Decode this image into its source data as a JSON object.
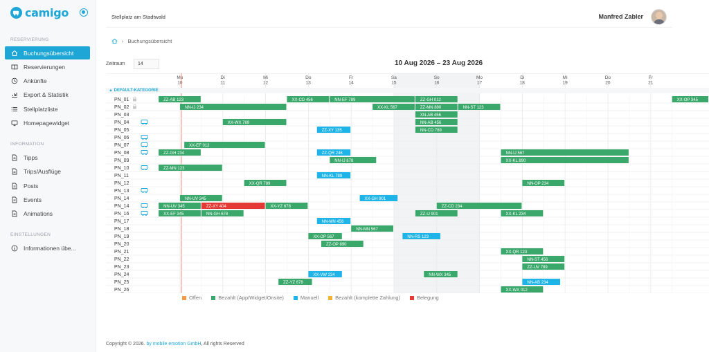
{
  "app": {
    "brand": "camigo",
    "site": "Stellplatz am Stadtwald",
    "user": "Manfred Zabler"
  },
  "sidebar": {
    "sections": [
      {
        "title": "RESERVIERUNG",
        "items": [
          {
            "label": "Buchungsübersicht",
            "icon": "home-icon",
            "active": true
          },
          {
            "label": "Reservierungen",
            "icon": "book-icon"
          },
          {
            "label": "Ankünfte",
            "icon": "clock-icon"
          },
          {
            "label": "Export & Statistik",
            "icon": "chart-icon"
          },
          {
            "label": "Stellplatzliste",
            "icon": "list-icon"
          },
          {
            "label": "Homepagewidget",
            "icon": "monitor-icon"
          }
        ]
      },
      {
        "title": "INFORMATION",
        "items": [
          {
            "label": "Tipps",
            "icon": "doc-icon"
          },
          {
            "label": "Trips/Ausflüge",
            "icon": "doc-icon"
          },
          {
            "label": "Posts",
            "icon": "doc-icon"
          },
          {
            "label": "Events",
            "icon": "doc-icon"
          },
          {
            "label": "Animations",
            "icon": "doc-icon"
          }
        ]
      },
      {
        "title": "EINSTELLUNGEN",
        "items": [
          {
            "label": "Informationen übe...",
            "icon": "info-icon"
          }
        ]
      }
    ]
  },
  "breadcrumb": {
    "current": "Buchungsübersicht"
  },
  "calendar": {
    "range_label": "10 Aug 2026 – 23 Aug 2026",
    "zeitraum_label": "Zeitraum",
    "zeitraum_value": "14",
    "category": "DEFAULT-KATEGORIE",
    "days": [
      {
        "dow": "Mo",
        "d": "10"
      },
      {
        "dow": "Di",
        "d": "11"
      },
      {
        "dow": "Mi",
        "d": "12"
      },
      {
        "dow": "Do",
        "d": "13"
      },
      {
        "dow": "Fr",
        "d": "14"
      },
      {
        "dow": "Sa",
        "d": "15"
      },
      {
        "dow": "So",
        "d": "16"
      },
      {
        "dow": "Mo",
        "d": "17"
      },
      {
        "dow": "Di",
        "d": "18"
      },
      {
        "dow": "Mi",
        "d": "19"
      },
      {
        "dow": "Do",
        "d": "20"
      },
      {
        "dow": "Fr",
        "d": "21"
      }
    ],
    "weekend_cols": [
      5,
      6
    ],
    "pitches": [
      {
        "name": "PN_01",
        "icon": "lock-icon"
      },
      {
        "name": "PN_02",
        "icon": "lock-icon"
      },
      {
        "name": "PN_03",
        "icon": ""
      },
      {
        "name": "PN_04",
        "icon": "camper-icon"
      },
      {
        "name": "PN_05",
        "icon": ""
      },
      {
        "name": "PN_06",
        "icon": "camper-icon"
      },
      {
        "name": "PN_07",
        "icon": "camper-icon"
      },
      {
        "name": "PN_08",
        "icon": "camper-icon"
      },
      {
        "name": "PN_09",
        "icon": ""
      },
      {
        "name": "PN_10",
        "icon": "camper-icon"
      },
      {
        "name": "PN_11",
        "icon": ""
      },
      {
        "name": "PN_12",
        "icon": ""
      },
      {
        "name": "PN_13",
        "icon": "camper-icon"
      },
      {
        "name": "PN_14",
        "icon": ""
      },
      {
        "name": "PN_14",
        "icon": "camper-icon"
      },
      {
        "name": "PN_16",
        "icon": "camper-icon"
      },
      {
        "name": "PN_17",
        "icon": ""
      },
      {
        "name": "PN_18",
        "icon": ""
      },
      {
        "name": "PN_19",
        "icon": ""
      },
      {
        "name": "PN_20",
        "icon": ""
      },
      {
        "name": "PN_21",
        "icon": ""
      },
      {
        "name": "PN_22",
        "icon": ""
      },
      {
        "name": "PN_23",
        "icon": ""
      },
      {
        "name": "PN_24",
        "icon": ""
      },
      {
        "name": "PN_25",
        "icon": ""
      },
      {
        "name": "PN_26",
        "icon": ""
      }
    ],
    "bookings": [
      {
        "row": 0,
        "start": -0.5,
        "end": 0.5,
        "label": "ZZ-AB 123",
        "status": "paid"
      },
      {
        "row": 0,
        "start": 2.5,
        "end": 3.5,
        "label": "XX-CD 456",
        "status": "paid"
      },
      {
        "row": 0,
        "start": 3.5,
        "end": 5.5,
        "label": "NN-EF 789",
        "status": "paid"
      },
      {
        "row": 0,
        "start": 5.5,
        "end": 6.5,
        "label": "ZZ-GH 012",
        "status": "paid"
      },
      {
        "row": 0,
        "start": 11.5,
        "end": 12.5,
        "label": "XX-OP 345",
        "status": "paid"
      },
      {
        "row": 1,
        "start": 0,
        "end": 2.5,
        "label": "NN-IJ 234",
        "status": "paid"
      },
      {
        "row": 1,
        "start": 4.5,
        "end": 5.5,
        "label": "XX-KL 567",
        "status": "paid"
      },
      {
        "row": 1,
        "start": 5.5,
        "end": 6.5,
        "label": "ZZ-MN 890",
        "status": "paid"
      },
      {
        "row": 1,
        "start": 6.5,
        "end": 7.5,
        "label": "NN-ST 123",
        "status": "paid"
      },
      {
        "row": 2,
        "start": 5.5,
        "end": 6.5,
        "label": "XN-AB 456",
        "status": "paid"
      },
      {
        "row": 3,
        "start": 1,
        "end": 2.5,
        "label": "XX-WX 789",
        "status": "paid"
      },
      {
        "row": 3,
        "start": 5.5,
        "end": 6.5,
        "label": "NN-AB 456",
        "status": "paid"
      },
      {
        "row": 4,
        "start": 3.2,
        "end": 4,
        "label": "ZZ-XY 135",
        "status": "manual"
      },
      {
        "row": 4,
        "start": 5.5,
        "end": 6.5,
        "label": "NN-CD 789",
        "status": "paid"
      },
      {
        "row": 6,
        "start": 0.1,
        "end": 2,
        "label": "XX-EF 012",
        "status": "paid"
      },
      {
        "row": 7,
        "start": -0.5,
        "end": 0.5,
        "label": "ZZ-GH 234",
        "status": "paid"
      },
      {
        "row": 7,
        "start": 3.2,
        "end": 4,
        "label": "ZZ-QR 246",
        "status": "manual"
      },
      {
        "row": 7,
        "start": 7.5,
        "end": 10.5,
        "label": "NN-IJ 567",
        "status": "paid"
      },
      {
        "row": 8,
        "start": 3.5,
        "end": 4.6,
        "label": "NN-IJ 678",
        "status": "paid"
      },
      {
        "row": 8,
        "start": 7.5,
        "end": 10.5,
        "label": "XX-KL 890",
        "status": "paid"
      },
      {
        "row": 9,
        "start": -0.5,
        "end": 1,
        "label": "ZZ-MN 123",
        "status": "paid"
      },
      {
        "row": 10,
        "start": 3.2,
        "end": 4,
        "label": "NN-KL 789",
        "status": "manual"
      },
      {
        "row": 11,
        "start": 1.5,
        "end": 2.5,
        "label": "XX-QR 789",
        "status": "paid"
      },
      {
        "row": 11,
        "start": 8,
        "end": 9,
        "label": "NN-OP 234",
        "status": "paid"
      },
      {
        "row": 13,
        "start": 0,
        "end": 1,
        "label": "NN-UV 345",
        "status": "paid"
      },
      {
        "row": 13,
        "start": 4.2,
        "end": 5.1,
        "label": "XX-GH 901",
        "status": "manual"
      },
      {
        "row": 14,
        "start": -0.5,
        "end": 0.5,
        "label": "NN-UV 345",
        "status": "paid"
      },
      {
        "row": 14,
        "start": 0.5,
        "end": 2,
        "label": "ZZ-XY 404",
        "status": "blocked"
      },
      {
        "row": 14,
        "start": 2,
        "end": 3,
        "label": "XX-YZ 678",
        "status": "paid"
      },
      {
        "row": 14,
        "start": 6,
        "end": 8,
        "label": "ZZ-CD 234",
        "status": "paid"
      },
      {
        "row": 15,
        "start": -0.5,
        "end": 0.5,
        "label": "XX-EF 345",
        "status": "paid"
      },
      {
        "row": 15,
        "start": 0.5,
        "end": 1.5,
        "label": "NN-GH 678",
        "status": "paid"
      },
      {
        "row": 15,
        "start": 5.5,
        "end": 6.5,
        "label": "ZZ-IJ 901",
        "status": "paid"
      },
      {
        "row": 15,
        "start": 7.5,
        "end": 8.5,
        "label": "XX-KL 234",
        "status": "paid"
      },
      {
        "row": 16,
        "start": 3.2,
        "end": 4,
        "label": "NN-MN 456",
        "status": "manual"
      },
      {
        "row": 17,
        "start": 4,
        "end": 5,
        "label": "NN-MN 567",
        "status": "paid"
      },
      {
        "row": 18,
        "start": 3,
        "end": 3.8,
        "label": "XX-OP 567",
        "status": "paid"
      },
      {
        "row": 18,
        "start": 5.2,
        "end": 6.1,
        "label": "NN-RS 123",
        "status": "manual"
      },
      {
        "row": 19,
        "start": 3.3,
        "end": 4.3,
        "label": "ZZ-OP 890",
        "status": "paid"
      },
      {
        "row": 20,
        "start": 7.5,
        "end": 8.5,
        "label": "XX-QR 123",
        "status": "paid"
      },
      {
        "row": 21,
        "start": 8,
        "end": 9,
        "label": "NN-ST 456",
        "status": "paid"
      },
      {
        "row": 22,
        "start": 8,
        "end": 9,
        "label": "ZZ-UV 789",
        "status": "paid"
      },
      {
        "row": 23,
        "start": 3,
        "end": 3.8,
        "label": "XX-VW 234",
        "status": "manual"
      },
      {
        "row": 23,
        "start": 5.7,
        "end": 6.5,
        "label": "NN-WX 345",
        "status": "paid"
      },
      {
        "row": 24,
        "start": 2.3,
        "end": 3.1,
        "label": "ZZ-YZ 678",
        "status": "paid"
      },
      {
        "row": 24,
        "start": 8,
        "end": 8.9,
        "label": "NN-AB 234",
        "status": "manual"
      },
      {
        "row": 25,
        "start": 7.5,
        "end": 8.5,
        "label": "XX-WX 012",
        "status": "paid"
      }
    ]
  },
  "legend": [
    {
      "label": "Offen",
      "color": "#f2994a"
    },
    {
      "label": "Bezahlt (App/Widget/Onsite)",
      "color": "#3aa86b"
    },
    {
      "label": "Manuell",
      "color": "#1fb4e8"
    },
    {
      "label": "Bezahlt (komplette Zahlung)",
      "color": "#f2b233"
    },
    {
      "label": "Belegung",
      "color": "#e53935"
    }
  ],
  "status_colors": {
    "paid": "#3aa86b",
    "manual": "#1fb4e8",
    "blocked": "#e53935",
    "open": "#f2994a"
  },
  "footer": {
    "copyright": "Copyright © 2026.",
    "company": "by mobile emotion GmbH",
    "rights": ", All rights Reserved"
  }
}
